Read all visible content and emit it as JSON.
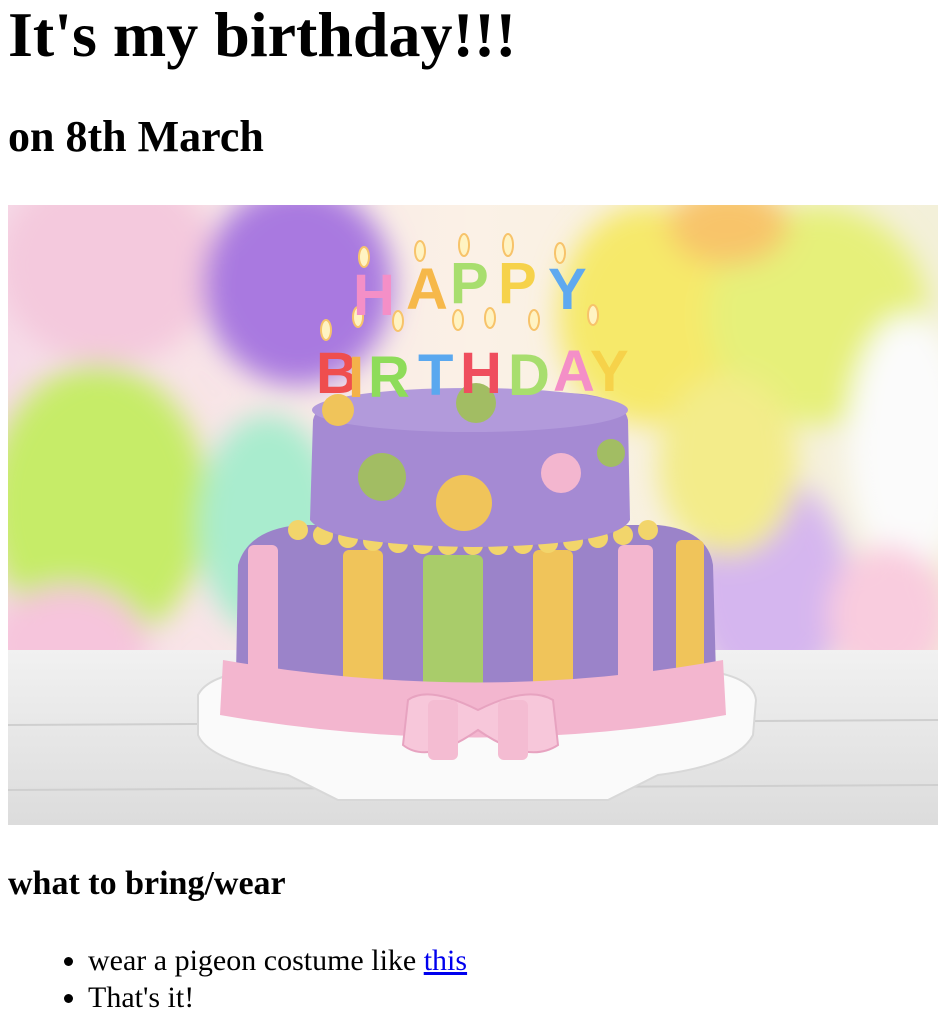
{
  "heading": "It's my birthday!!!",
  "subheading": "on 8th March",
  "image": {
    "description_icon": "birthday-cake-photo",
    "candle_letters_top": "HAPPY",
    "candle_letters_bottom": "BIRTHDAY"
  },
  "section_title": "what to bring/wear",
  "list": {
    "item1_text": "wear a pigeon costume like ",
    "item1_link": "this",
    "item2_text": "That's it!"
  },
  "colors": {
    "link": "#0000ee",
    "cake_purple": "#9b83c9",
    "ribbon_pink": "#f3b6cf",
    "stripe_yellow": "#f0c45a",
    "stripe_green": "#a9cc6a"
  }
}
